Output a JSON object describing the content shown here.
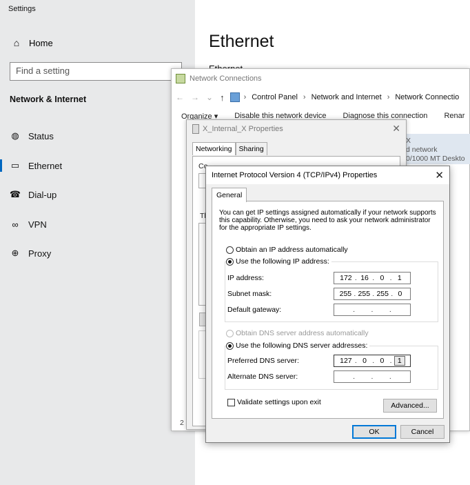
{
  "settings": {
    "title": "Settings",
    "home_label": "Home",
    "search_placeholder": "Find a setting",
    "section_title": "Network & Internet",
    "nav": [
      {
        "label": "Status",
        "icon": "globe-status-icon"
      },
      {
        "label": "Ethernet",
        "icon": "ethernet-icon",
        "selected": true
      },
      {
        "label": "Dial-up",
        "icon": "dialup-icon"
      },
      {
        "label": "VPN",
        "icon": "vpn-icon"
      },
      {
        "label": "Proxy",
        "icon": "proxy-globe-icon"
      }
    ],
    "page_heading": "Ethernet",
    "page_sub": "Ethernet"
  },
  "network_connections": {
    "title": "Network Connections",
    "address": [
      "Control Panel",
      "Network and Internet",
      "Network Connectio"
    ],
    "toolbar": [
      "Organize ▾",
      "Disable this network device",
      "Diagnose this connection",
      "Renar"
    ],
    "adapter_lines": [
      "X",
      "d network",
      "0/1000 MT Deskto"
    ],
    "status_text": "2 items"
  },
  "adapter_properties": {
    "title": "X_Internal_X Properties",
    "tabs": [
      "Networking",
      "Sharing"
    ],
    "connect_label": "Co",
    "items_label": "Th"
  },
  "ipv4_dialog": {
    "title": "Internet Protocol Version 4 (TCP/IPv4) Properties",
    "tab": "General",
    "description": "You can get IP settings assigned automatically if your network supports this capability. Otherwise, you need to ask your network administrator for the appropriate IP settings.",
    "obtain_ip_auto": "Obtain an IP address automatically",
    "use_following_ip": "Use the following IP address:",
    "ip_address_label": "IP address:",
    "ip_address": [
      "172",
      "16",
      "0",
      "1"
    ],
    "subnet_label": "Subnet mask:",
    "subnet_mask": [
      "255",
      "255",
      "255",
      "0"
    ],
    "gateway_label": "Default gateway:",
    "gateway": [
      "",
      "",
      "",
      ""
    ],
    "obtain_dns_auto": "Obtain DNS server address automatically",
    "use_following_dns": "Use the following DNS server addresses:",
    "preferred_dns_label": "Preferred DNS server:",
    "preferred_dns": [
      "127",
      "0",
      "0",
      "1"
    ],
    "alternate_dns_label": "Alternate DNS server:",
    "alternate_dns": [
      "",
      "",
      "",
      ""
    ],
    "validate_label": "Validate settings upon exit",
    "advanced_label": "Advanced...",
    "ok_label": "OK",
    "cancel_label": "Cancel"
  }
}
